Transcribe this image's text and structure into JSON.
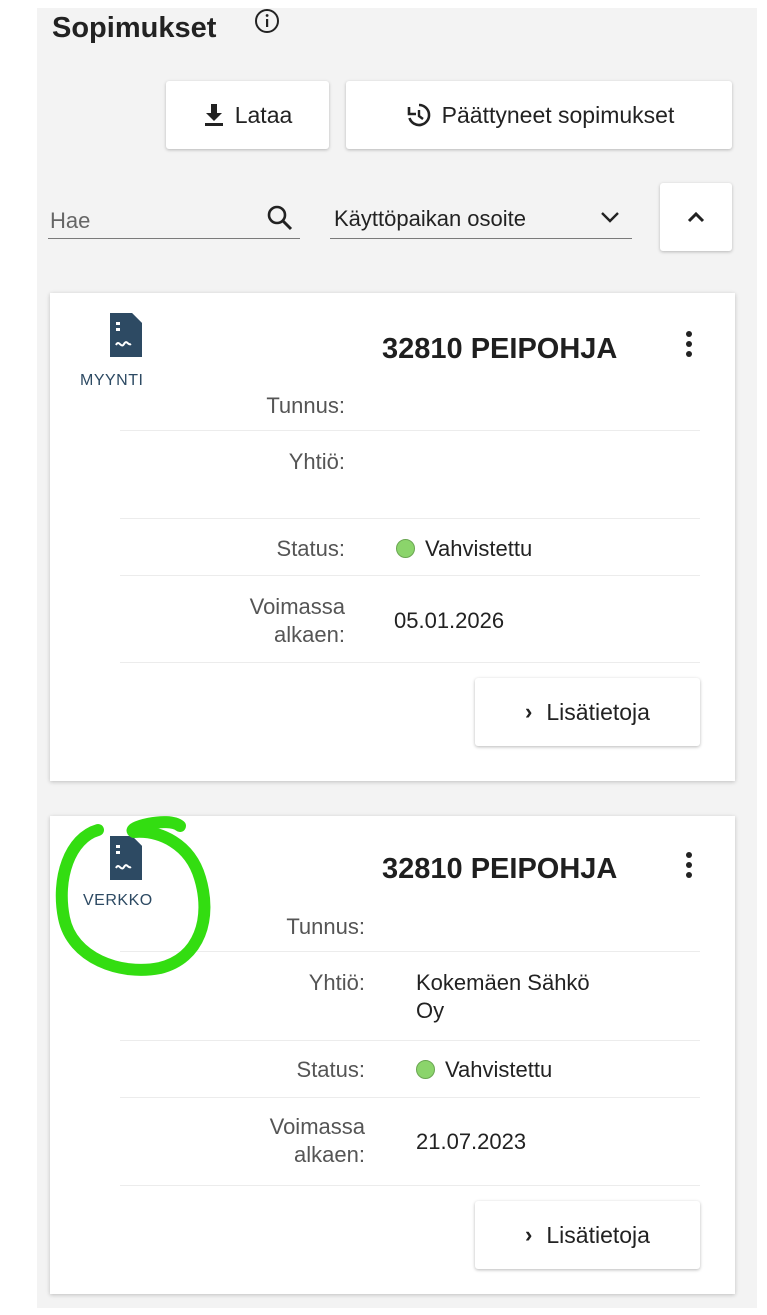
{
  "header": {
    "title": "Sopimukset",
    "download_label": "Lataa",
    "ended_label": "Päättyneet sopimukset"
  },
  "filters": {
    "search_placeholder": "Hae",
    "sort_select": "Käyttöpaikan osoite"
  },
  "cards": [
    {
      "type_label": "MYYNTI",
      "address": "32810 PEIPOHJA",
      "rows": {
        "tunnus_label": "Tunnus:",
        "tunnus_value": "",
        "yhtio_label": "Yhtiö:",
        "yhtio_value": "",
        "status_label": "Status:",
        "status_value": "Vahvistettu",
        "voimassa_label_1": "Voimassa",
        "voimassa_label_2": "alkaen:",
        "voimassa_value": "05.01.2026"
      },
      "more_label": "Lisätietoja"
    },
    {
      "type_label": "VERKKO",
      "address": "32810 PEIPOHJA",
      "rows": {
        "tunnus_label": "Tunnus:",
        "tunnus_value": "",
        "yhtio_label": "Yhtiö:",
        "yhtio_value_1": "Kokemäen Sähkö",
        "yhtio_value_2": "Oy",
        "status_label": "Status:",
        "status_value": "Vahvistettu",
        "voimassa_label_1": "Voimassa",
        "voimassa_label_2": "alkaen:",
        "voimassa_value": "21.07.2023"
      },
      "more_label": "Lisätietoja"
    }
  ],
  "colors": {
    "status_ok": "#8bd46b",
    "icon": "#2d4a63",
    "highlight": "#33dd11"
  }
}
